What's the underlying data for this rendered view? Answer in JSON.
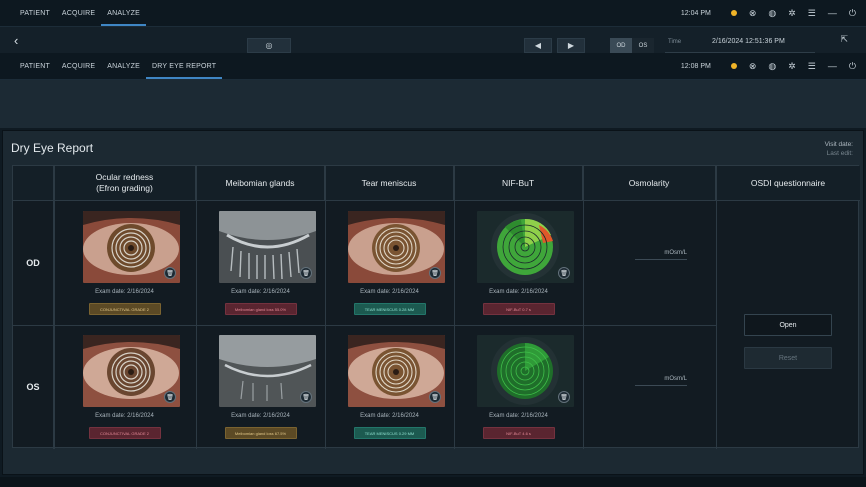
{
  "top_nav": {
    "tabs": [
      {
        "label": "PATIENT",
        "active": false
      },
      {
        "label": "ACQUIRE",
        "active": false
      },
      {
        "label": "ANALYZE",
        "active": true
      }
    ],
    "clock": "12:04 PM"
  },
  "sub_toolbar": {
    "od_label": "OD",
    "os_label": "OS",
    "time_label": "Time",
    "time_value": "2/16/2024 12:51:36 PM"
  },
  "second_nav": {
    "tabs": [
      {
        "label": "PATIENT",
        "active": false
      },
      {
        "label": "ACQUIRE",
        "active": false
      },
      {
        "label": "ANALYZE",
        "active": false
      },
      {
        "label": "DRY EYE REPORT",
        "active": true
      }
    ],
    "clock": "12:08 PM"
  },
  "report": {
    "title": "Dry Eye Report",
    "visit_date_label": "Visit date:",
    "last_edit_label": "Last edit:",
    "columns": [
      {
        "label": "Ocular redness\n(Efron grading)"
      },
      {
        "label": "Meibomian glands"
      },
      {
        "label": "Tear meniscus"
      },
      {
        "label": "NIF-BuT"
      },
      {
        "label": "Osmolarity"
      },
      {
        "label": "OSDI questionnaire"
      }
    ],
    "rows": [
      {
        "eye": "OD",
        "redness": {
          "exam": "Exam date: 2/16/2024",
          "tag": "CONJUNCTIVAL GRADE 2"
        },
        "meibo": {
          "exam": "Exam date: 2/16/2024",
          "tag": "Meibomian gland loss 55.0%"
        },
        "tear": {
          "exam": "Exam date: 2/16/2024",
          "tag": "TEAR MENISCUS 0.28 MM"
        },
        "nifbut": {
          "exam": "Exam date: 2/16/2024",
          "tag": "NIF-BuT 0.7 s"
        },
        "osm_unit": "mOsm/L"
      },
      {
        "eye": "OS",
        "redness": {
          "exam": "Exam date: 2/16/2024",
          "tag": "CONJUNCTIVAL GRADE 2"
        },
        "meibo": {
          "exam": "Exam date: 2/16/2024",
          "tag": "Meibomian gland loss 67.5%"
        },
        "tear": {
          "exam": "Exam date: 2/16/2024",
          "tag": "TEAR MENISCUS 0.29 MM"
        },
        "nifbut": {
          "exam": "Exam date: 2/16/2024",
          "tag": "NIF-BuT 4.6 s"
        },
        "osm_unit": "mOsm/L"
      }
    ],
    "osdi": {
      "open_label": "Open",
      "reset_label": "Reset"
    }
  },
  "colors": {
    "accent": "#3f86c4",
    "status_dot": "#f0b428",
    "gold_tag": "#5c4a25",
    "red_tag": "#5a2530",
    "teal_tag": "#1c5a50"
  }
}
